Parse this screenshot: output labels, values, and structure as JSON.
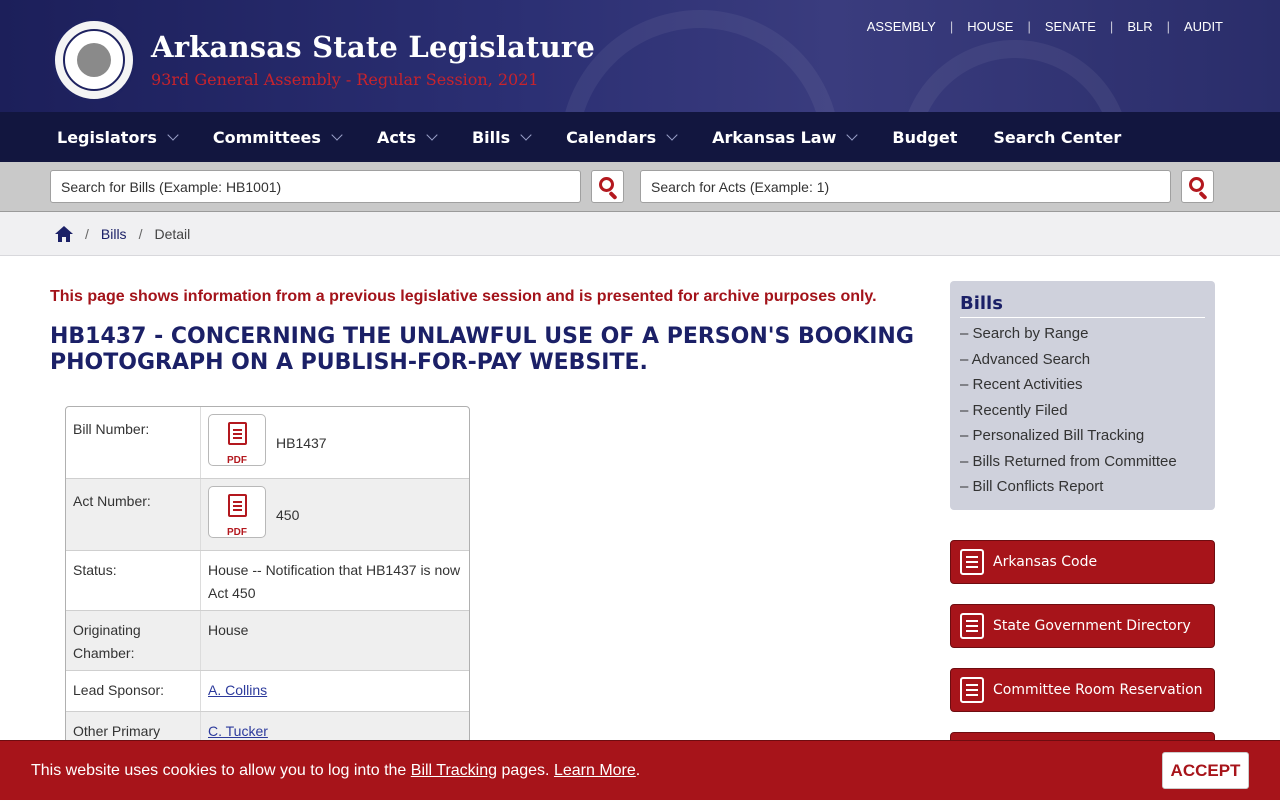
{
  "header": {
    "title": "Arkansas State Legislature",
    "subtitle": "93rd General Assembly - Regular Session, 2021",
    "utility_nav": [
      "ASSEMBLY",
      "HOUSE",
      "SENATE",
      "BLR",
      "AUDIT"
    ]
  },
  "main_nav": [
    {
      "label": "Legislators",
      "dropdown": true
    },
    {
      "label": "Committees",
      "dropdown": true
    },
    {
      "label": "Acts",
      "dropdown": true
    },
    {
      "label": "Bills",
      "dropdown": true
    },
    {
      "label": "Calendars",
      "dropdown": true
    },
    {
      "label": "Arkansas Law",
      "dropdown": true
    },
    {
      "label": "Budget",
      "dropdown": false
    },
    {
      "label": "Search Center",
      "dropdown": false
    }
  ],
  "search": {
    "bills_placeholder": "Search for Bills (Example: HB1001)",
    "acts_placeholder": "Search for Acts (Example: 1)"
  },
  "breadcrumb": {
    "items": [
      "Bills",
      "Detail"
    ]
  },
  "archive_notice": "This page shows information from a previous legislative session and is presented for archive purposes only.",
  "bill_title": "HB1437 - CONCERNING THE UNLAWFUL USE OF A PERSON'S BOOKING PHOTOGRAPH ON A PUBLISH-FOR-PAY WEBSITE.",
  "bill_details": {
    "bill_number_label": "Bill Number:",
    "bill_number": "HB1437",
    "act_number_label": "Act Number:",
    "act_number": "450",
    "pdf_label": "PDF",
    "status_label": "Status:",
    "status": "House -- Notification that HB1437 is now Act 450",
    "chamber_label": "Originating Chamber:",
    "chamber": "House",
    "lead_sponsor_label": "Lead Sponsor:",
    "lead_sponsor": "A. Collins",
    "other_sponsor_label": "Other Primary",
    "other_sponsor": "C. Tucker"
  },
  "sidebar": {
    "title": "Bills",
    "links": [
      "– Search by Range",
      "– Advanced Search",
      "– Recent Activities",
      "– Recently Filed",
      "– Personalized Bill Tracking",
      "– Bills Returned from Committee",
      "– Bill Conflicts Report"
    ],
    "buttons": [
      {
        "label": "Arkansas Code",
        "icon": "book-icon"
      },
      {
        "label": "State Government Directory",
        "icon": "building-icon"
      },
      {
        "label": "Committee Room Reservation",
        "icon": "bookmark-icon"
      }
    ]
  },
  "cookie": {
    "text_before": "This website uses cookies to allow you to log into the ",
    "link1": "Bill Tracking",
    "text_middle": " pages. ",
    "link2": "Learn More",
    "text_after": ".",
    "accept": "ACCEPT"
  },
  "colors": {
    "navy": "#1b2067",
    "red": "#a7141a"
  }
}
